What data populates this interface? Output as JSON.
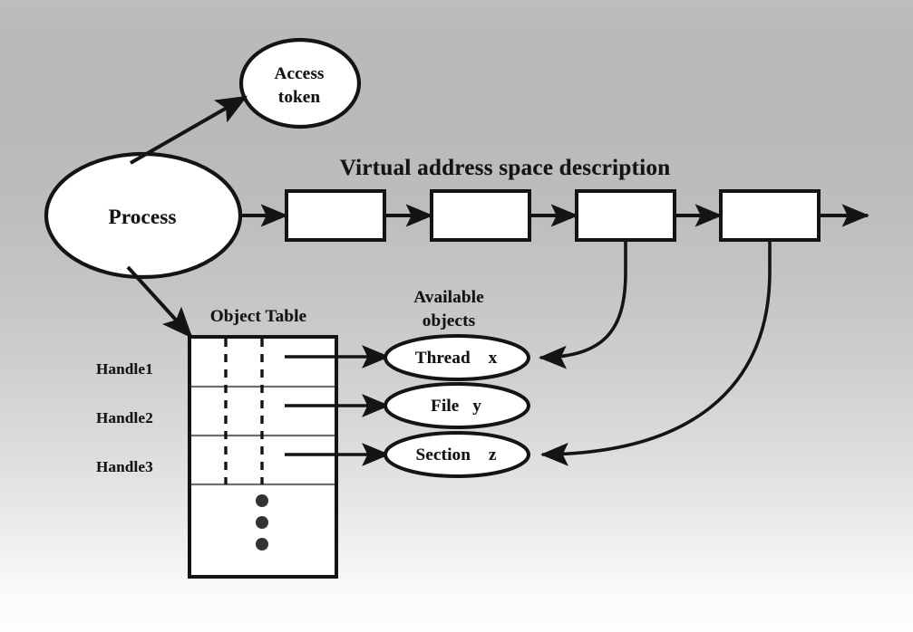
{
  "diagram": {
    "title": "Virtual address space description",
    "nodes": {
      "process": {
        "label": "Process",
        "shape": "ellipse"
      },
      "access_token": {
        "line1": "Access",
        "line2": "token",
        "shape": "ellipse"
      }
    },
    "vas_boxes": [
      {
        "label": ""
      },
      {
        "label": ""
      },
      {
        "label": ""
      },
      {
        "label": ""
      }
    ],
    "object_table": {
      "caption": "Object Table",
      "handles": [
        {
          "label": "Handle1"
        },
        {
          "label": "Handle2"
        },
        {
          "label": "Handle3"
        }
      ],
      "continuation": "vertical-ellipsis-dots",
      "dot_count": 3,
      "column_dividers": 2,
      "divider_style": "dashed"
    },
    "available_objects": {
      "caption_line1": "Available",
      "caption_line2": "objects",
      "items": [
        {
          "name": "Thread",
          "handle": "x",
          "label": "Thread    x"
        },
        {
          "name": "File",
          "handle": "y",
          "label": "File   y"
        },
        {
          "name": "Section",
          "handle": "z",
          "label": "Section    z"
        }
      ]
    },
    "colors": {
      "stroke": "#141414",
      "fill": "#ffffff",
      "row_divider": "#6f6f6f",
      "background_top": "#bababa",
      "background_bottom": "#fdfdfd"
    }
  }
}
